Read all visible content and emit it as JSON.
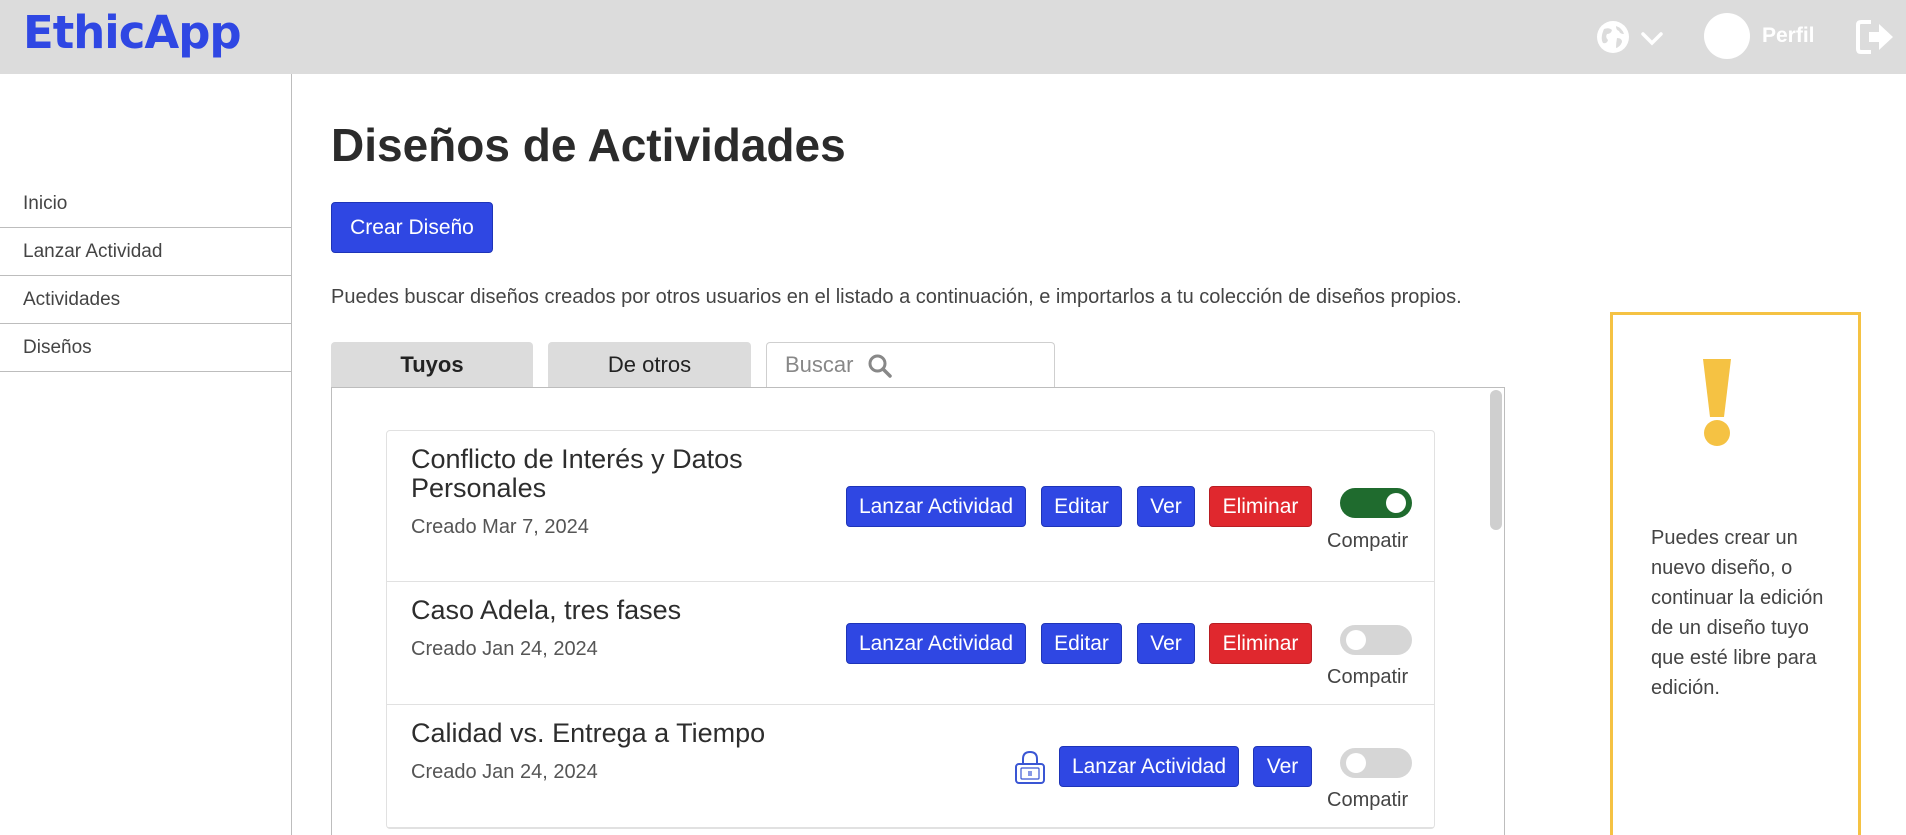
{
  "header": {
    "brand": "EthicApp",
    "language_icon": "globe-icon",
    "profile_label": "Perfil",
    "logout_icon": "logout-icon"
  },
  "sidebar": {
    "items": [
      {
        "label": "Inicio"
      },
      {
        "label": "Lanzar Actividad"
      },
      {
        "label": "Actividades"
      },
      {
        "label": "Diseños"
      }
    ]
  },
  "main": {
    "title": "Diseños de Actividades",
    "create_button": "Crear Diseño",
    "intro": "Puedes buscar diseños creados por otros usuarios en el listado a continuación, e importarlos a tu colección de diseños propios.",
    "tabs": [
      {
        "label": "Tuyos",
        "active": true
      },
      {
        "label": "De otros",
        "active": false
      }
    ],
    "search": {
      "placeholder": "Buscar"
    },
    "designs": [
      {
        "title": "Conflicto de Interés y Datos Personales",
        "date": "Creado Mar 7, 2024",
        "launch": "Lanzar Actividad",
        "edit": "Editar",
        "view": "Ver",
        "delete": "Eliminar",
        "shared": true,
        "share_label": "Compatir"
      },
      {
        "title": "Caso Adela, tres fases",
        "date": "Creado Jan 24, 2024",
        "launch": "Lanzar Actividad",
        "edit": "Editar",
        "view": "Ver",
        "delete": "Eliminar",
        "shared": false,
        "share_label": "Compatir"
      },
      {
        "title": "Calidad vs. Entrega a Tiempo",
        "date": "Creado Jan 24, 2024",
        "launch": "Lanzar Actividad",
        "view": "Ver",
        "locked": true,
        "shared": false,
        "share_label": "Compatir"
      }
    ]
  },
  "info_panel": {
    "icon": "exclamation-icon",
    "text": "Puedes crear un nuevo diseño, o continuar la edición de un diseño tuyo que esté libre para edición."
  },
  "colors": {
    "brand": "#2f47e3",
    "primary_button": "#2f47e3",
    "danger_button": "#e0282e",
    "toggle_on": "#1f6b2e",
    "info_border": "#f5c243"
  }
}
